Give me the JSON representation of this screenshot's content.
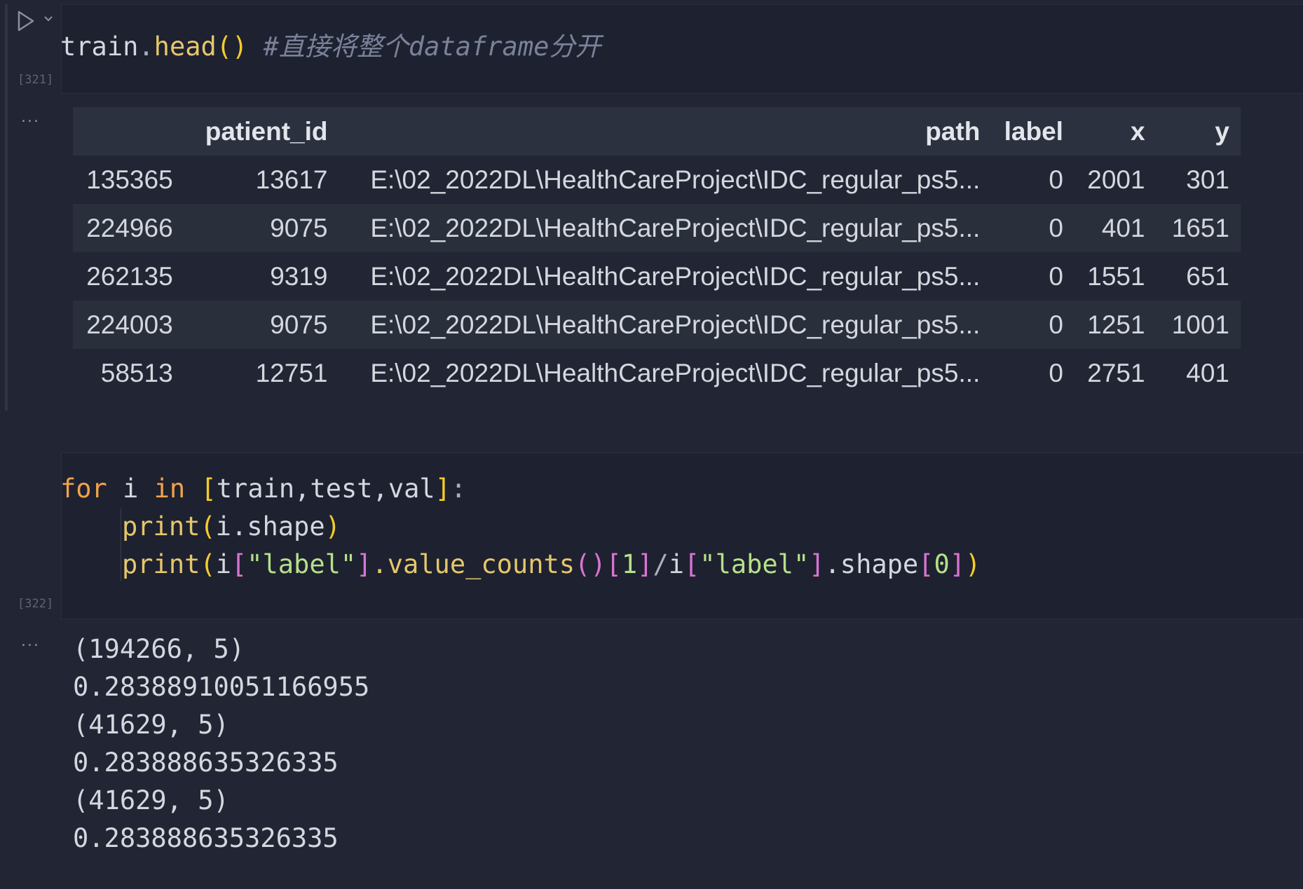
{
  "cells": [
    {
      "execution_count": "[321]",
      "code": {
        "var": "train",
        "dot": ".",
        "fn": "head",
        "paren": "()",
        "comment": "#直接将整个dataframe分开"
      },
      "output": {
        "ellipsis": "...",
        "columns": [
          "",
          "patient_id",
          "path",
          "label",
          "x",
          "y"
        ],
        "rows": [
          [
            "135365",
            "13617",
            "E:\\02_2022DL\\HealthCareProject\\IDC_regular_ps5...",
            "0",
            "2001",
            "301"
          ],
          [
            "224966",
            "9075",
            "E:\\02_2022DL\\HealthCareProject\\IDC_regular_ps5...",
            "0",
            "401",
            "1651"
          ],
          [
            "262135",
            "9319",
            "E:\\02_2022DL\\HealthCareProject\\IDC_regular_ps5...",
            "0",
            "1551",
            "651"
          ],
          [
            "224003",
            "9075",
            "E:\\02_2022DL\\HealthCareProject\\IDC_regular_ps5...",
            "0",
            "1251",
            "1001"
          ],
          [
            "58513",
            "12751",
            "E:\\02_2022DL\\HealthCareProject\\IDC_regular_ps5...",
            "0",
            "2751",
            "401"
          ]
        ]
      }
    },
    {
      "execution_count": "[322]",
      "code_lines": {
        "l1": {
          "kw_for": "for",
          "i": " i ",
          "kw_in": "in",
          "sp": " ",
          "lb": "[",
          "list": "train,test,val",
          "rb": "]",
          "colon": ":"
        },
        "l2": {
          "fn": "print",
          "lp": "(",
          "arg": "i.shape",
          "rp": ")"
        },
        "l3": {
          "fn": "print",
          "lp": "(",
          "i1": "i",
          "lb1": "[",
          "s1": "\"label\"",
          "rb1": "]",
          "mid": ".value_counts",
          "pp": "()",
          "lb2": "[",
          "n1": "1",
          "rb2": "]",
          "slash": "/",
          "i2": "i",
          "lb3": "[",
          "s2": "\"label\"",
          "rb3": "]",
          "sh": ".shape",
          "lb4": "[",
          "n0": "0",
          "rb4": "]",
          "rp": ")"
        }
      },
      "output": {
        "ellipsis": "...",
        "lines": [
          "(194266, 5)",
          "0.28388910051166955",
          "(41629, 5)",
          "0.283888635326335",
          "(41629, 5)",
          "0.283888635326335"
        ]
      }
    }
  ],
  "icons": {
    "run": "run-cell-icon",
    "chevron": "chevron-down-icon"
  }
}
